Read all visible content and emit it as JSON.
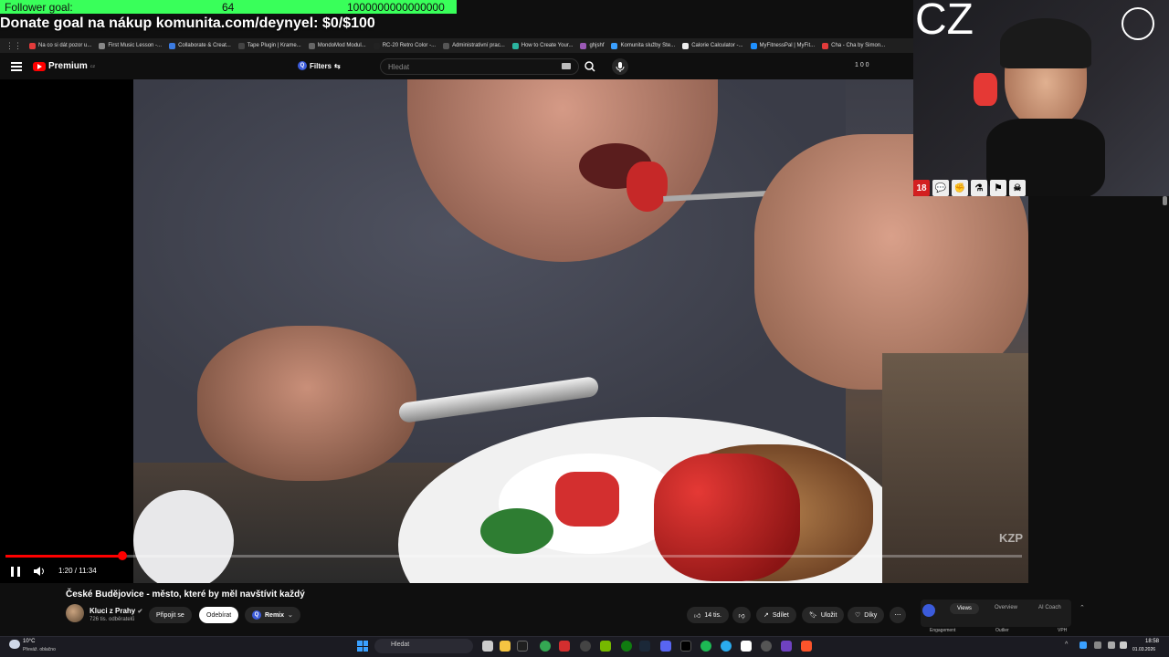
{
  "overlay": {
    "follower_label": "Follower goal:",
    "follower_current": "64",
    "follower_target": "1000000000000000",
    "donate_text": "Donate goal na nákup komunita.com/deynyel: $0/$100",
    "cz_text": "CZ",
    "badge_18": "18"
  },
  "bookmarks": [
    {
      "label": "Na co si dát pozor u...",
      "color": "#e23b3b"
    },
    {
      "label": "First Music Lesson -...",
      "color": "#888888"
    },
    {
      "label": "Collaborate & Creat...",
      "color": "#3b7be2"
    },
    {
      "label": "Tape Plugin | Krame...",
      "color": "#444444"
    },
    {
      "label": "MondoMod Modul...",
      "color": "#666666"
    },
    {
      "label": "RC-20 Retro Color -...",
      "color": "#222222"
    },
    {
      "label": "Administrativní prac...",
      "color": "#555555"
    },
    {
      "label": "How to Create Your...",
      "color": "#2bb5a0"
    },
    {
      "label": "ghjshf",
      "color": "#9b59b6"
    },
    {
      "label": "Komunita služby Ste...",
      "color": "#3aa0ff"
    },
    {
      "label": "Calorie Calculator -...",
      "color": "#eeeeee"
    },
    {
      "label": "MyFitnessPal | MyFit...",
      "color": "#1e90ff"
    },
    {
      "label": "Cha - Cha by Simon...",
      "color": "#e23b3b"
    }
  ],
  "header": {
    "brand": "Premium",
    "region": "CZ",
    "filters_label": "Filters",
    "search_placeholder": "Hledat",
    "counters": "1  0  0"
  },
  "player": {
    "current_time": "1:20",
    "duration": "11:34",
    "time_display": "1:20 / 11:34",
    "progress": 0.1153,
    "watermark": "KZP"
  },
  "video": {
    "title": "České Budějovice - město, které by měl navštívit každý",
    "channel": "Kluci z Prahy",
    "subscribers": "726 tis. odběratelů",
    "join_label": "Připojit se",
    "subscribe_label": "Odebírat",
    "remix_label": "Remix",
    "likes": "14 tis.",
    "share_label": "Sdílet",
    "save_label": "Uložit",
    "thanks_label": "Díky"
  },
  "extension": {
    "tabs": [
      "Views",
      "Overview",
      "AI Coach"
    ],
    "columns": [
      "Engagement",
      "Outlier",
      "VPH"
    ]
  },
  "taskbar": {
    "weather_temp": "10°C",
    "weather_desc": "Převáž. oblačno",
    "search_label": "Hledat",
    "time": "18:58",
    "date": "01.03.2026"
  }
}
